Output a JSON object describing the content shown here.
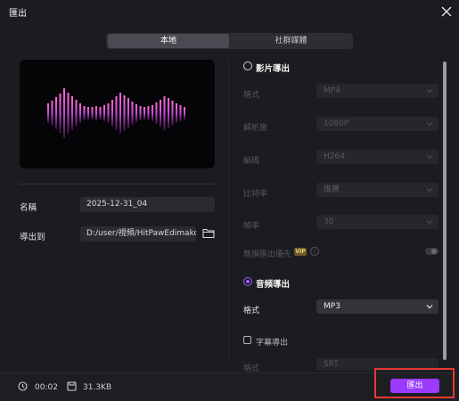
{
  "window": {
    "title": "匯出"
  },
  "tabs": [
    {
      "label": "本地"
    },
    {
      "label": "社群媒體"
    }
  ],
  "left": {
    "name_label": "名稱",
    "name_value": "2025-12-31_04",
    "export_to_label": "導出到",
    "path_value": "D:/user/視頻/HitPawEdimakor"
  },
  "video": {
    "title": "影片導出",
    "rows": [
      {
        "label": "格式",
        "value": "MP4"
      },
      {
        "label": "解析度",
        "value": "1080P"
      },
      {
        "label": "編碼",
        "value": "H264"
      },
      {
        "label": "比特率",
        "value": "推薦"
      },
      {
        "label": "幀率",
        "value": "30"
      }
    ],
    "lossless_label": "無損匯出優先",
    "vip_badge": "VIP",
    "info_glyph": "i"
  },
  "audio": {
    "title": "音頻導出",
    "format_label": "格式",
    "format_value": "MP3"
  },
  "subtitle": {
    "title": "字幕導出",
    "format_label": "格式",
    "format_value": "SRT"
  },
  "footer": {
    "duration": "00:02",
    "size": "31.3KB",
    "export_button": "匯出"
  },
  "colors": {
    "accent": "#9b3bff",
    "highlight": "#e53935",
    "background": "#1b1c20"
  }
}
